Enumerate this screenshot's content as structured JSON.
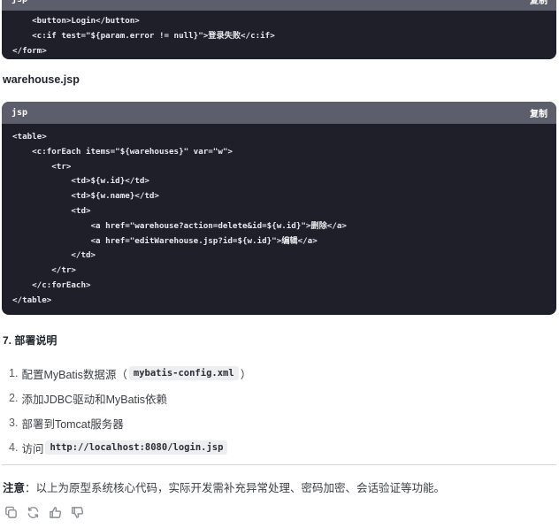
{
  "code_block_1": {
    "lang": "jsp",
    "copy_label": "复制",
    "lines": [
      "    <button>Login</button>",
      "    <c:if test=\"${param.error != null}\">登录失败</c:if>",
      "</form>"
    ]
  },
  "file_title": "warehouse.jsp",
  "code_block_2": {
    "lang": "jsp",
    "copy_label": "复制",
    "lines": [
      "<table>",
      "    <c:forEach items=\"${warehouses}\" var=\"w\">",
      "        <tr>",
      "            <td>${w.id}</td>",
      "            <td>${w.name}</td>",
      "            <td>",
      "                <a href=\"warehouse?action=delete&id=${w.id}\">删除</a>",
      "                <a href=\"editWarehouse.jsp?id=${w.id}\">编辑</a>",
      "            </td>",
      "        </tr>",
      "    </c:forEach>",
      "</table>"
    ]
  },
  "section_title": "7. 部署说明",
  "steps": [
    {
      "num": "1.",
      "text": "配置MyBatis数据源（",
      "code": "mybatis-config.xml",
      "after": "）"
    },
    {
      "num": "2.",
      "text": "添加JDBC驱动和MyBatis依赖",
      "code": "",
      "after": ""
    },
    {
      "num": "3.",
      "text": "部署到Tomcat服务器",
      "code": "",
      "after": ""
    },
    {
      "num": "4.",
      "text": "访问 ",
      "code": "http://localhost:8080/login.jsp",
      "after": ""
    }
  ],
  "note": {
    "label": "注意",
    "text": "：以上为原型系统核心代码，实际开发需补充异常处理、密码加密、会话验证等功能。"
  },
  "actions": [
    {
      "name": "copy-icon"
    },
    {
      "name": "regenerate-icon"
    },
    {
      "name": "thumbs-up-icon"
    },
    {
      "name": "thumbs-down-icon"
    }
  ]
}
